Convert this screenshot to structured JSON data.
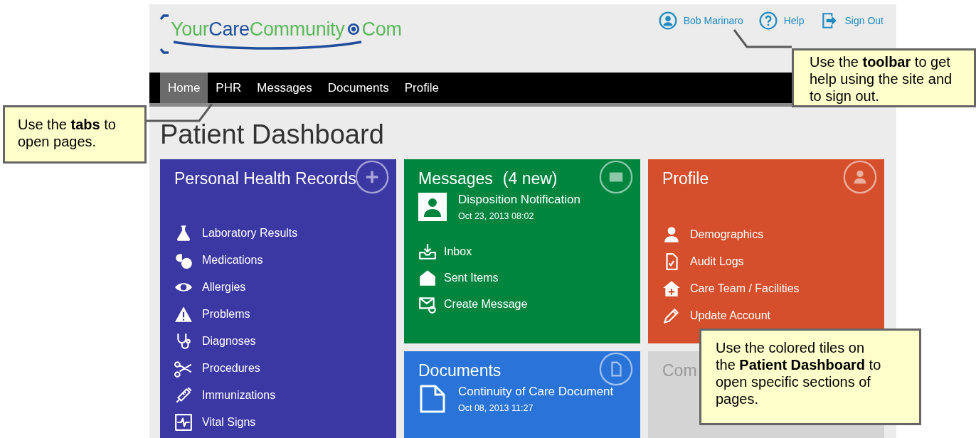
{
  "logo": {
    "segments": [
      {
        "text": "Your",
        "color": "#5cb85c"
      },
      {
        "text": "Care",
        "color": "#1f4e9c"
      },
      {
        "text": "Community",
        "color": "#5cb85c"
      },
      {
        "text": "Com",
        "color": "#5cb85c"
      }
    ]
  },
  "toolbar": [
    {
      "label": "Bob Marinaro",
      "kind": "user"
    },
    {
      "label": "Help",
      "kind": "help"
    },
    {
      "label": "Sign Out",
      "kind": "signout"
    }
  ],
  "tabs": [
    {
      "label": "Home",
      "selected": true
    },
    {
      "label": "PHR",
      "selected": false
    },
    {
      "label": "Messages",
      "selected": false
    },
    {
      "label": "Documents",
      "selected": false
    },
    {
      "label": "Profile",
      "selected": false
    }
  ],
  "page_title": "Patient Dashboard",
  "tiles": [
    {
      "kind": "phr",
      "title": "Personal Health Records",
      "color": "#3b37a3",
      "links": [
        "Laboratory Results",
        "Medications",
        "Allergies",
        "Problems",
        "Diagnoses",
        "Procedures",
        "Immunizations",
        "Vital Signs"
      ]
    },
    {
      "kind": "messages",
      "title": "Messages",
      "count": "(4 new)",
      "color": "#00853f",
      "latest": {
        "subject": "Disposition Notification",
        "date": "Oct 23, 2013 08:02"
      },
      "links": [
        "Inbox",
        "Sent Items",
        "Create Message"
      ]
    },
    {
      "kind": "profile",
      "title": "Profile",
      "color": "#d64f2c",
      "links": [
        "Demographics",
        "Audit Logs",
        "Care Team / Facilities",
        "Update Account"
      ]
    },
    {
      "kind": "documents",
      "title": "Documents",
      "color": "#2a74d9",
      "latest": {
        "subject": "Continuity of Care Document",
        "date": "Oct 08, 2013 11:27"
      }
    },
    {
      "kind": "blank",
      "title": "Com",
      "color": "#d4d4d4"
    }
  ],
  "callouts": [
    {
      "kind": "tabs",
      "text": "Use the **tabs** to open pages."
    },
    {
      "kind": "toolbar",
      "text": "Use the **toolbar** to get help using the site and to sign out."
    },
    {
      "kind": "tiles",
      "text": "Use the colored tiles on the **Patient Dashboard** to open specific sections of pages."
    }
  ]
}
